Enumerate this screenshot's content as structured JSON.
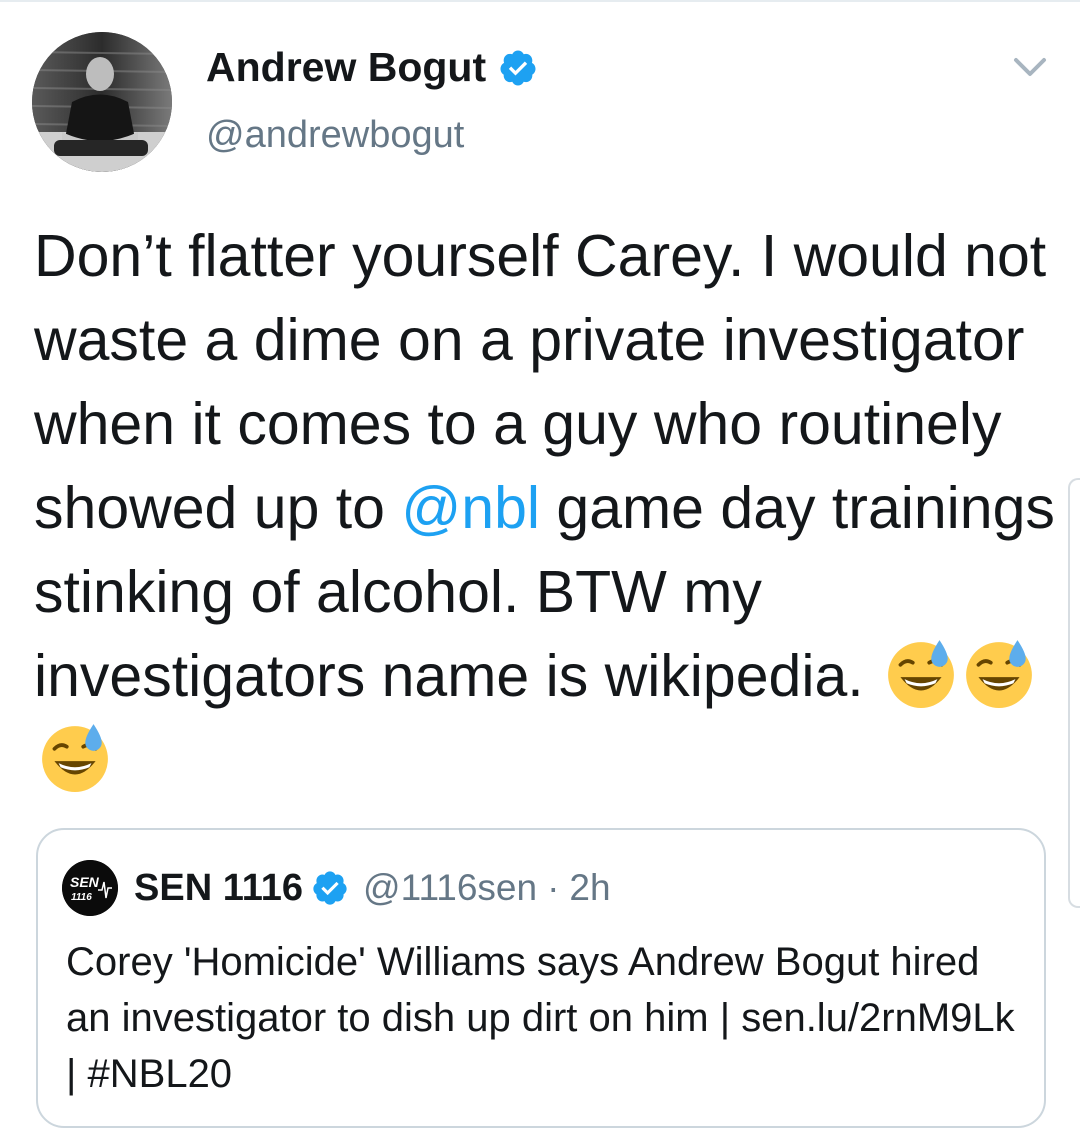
{
  "author": {
    "display_name": "Andrew Bogut",
    "handle": "@andrewbogut",
    "verified": true,
    "avatar_icon": "profile-photo"
  },
  "tweet": {
    "text_part1": "Don’t flatter yourself Carey. I would not waste a dime on a private investigator when it comes to a guy who routinely showed up to ",
    "mention": "@nbl",
    "text_part2": " game day trainings stinking of alcohol. BTW my investigators name is wikipedia. ",
    "emojis": [
      "grinning-face-with-sweat",
      "grinning-face-with-sweat",
      "grinning-face-with-sweat"
    ]
  },
  "quoted_tweet": {
    "display_name": "SEN 1116",
    "verified": true,
    "handle": "@1116sen",
    "separator": "·",
    "time": "2h",
    "text": "Corey 'Homicide' Williams says Andrew Bogut hired an investigator to dish up dirt on him | sen.lu/2rnM9Lk | #NBL20",
    "avatar_icon": "sen-logo"
  },
  "menu": {
    "icon": "chevron-down-icon"
  },
  "colors": {
    "link": "#1da1f2",
    "text": "#14171a",
    "secondary": "#657786",
    "border": "#ccd6dd",
    "verified": "#1da1f2"
  }
}
